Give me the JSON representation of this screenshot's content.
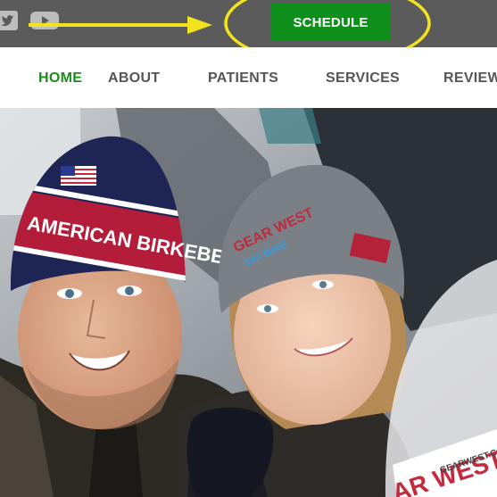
{
  "social": {
    "icons": [
      "twitter-icon",
      "youtube-icon"
    ]
  },
  "header": {
    "schedule_label": "SCHEDULE"
  },
  "nav": {
    "items": [
      {
        "label": "HOME",
        "active": true
      },
      {
        "label": "ABOUT",
        "active": false
      },
      {
        "label": "PATIENTS",
        "active": false
      },
      {
        "label": "SERVICES",
        "active": false
      },
      {
        "label": "REVIEWS",
        "active": false
      }
    ]
  },
  "hero": {
    "hat_left_text": "AMERICAN BIRKEBEINER",
    "hat_right_text": "GEAR WEST",
    "hat_right_sub": "SKI BIKE",
    "bib_text": "AR WEST",
    "bib_url": "GEARWEST.COM"
  },
  "colors": {
    "topbar": "#5b5b5b",
    "schedule_bg": "#0f8f1b",
    "annotation": "#f2e41c",
    "nav_active": "#1f8a1f",
    "nav_text": "#555555"
  }
}
